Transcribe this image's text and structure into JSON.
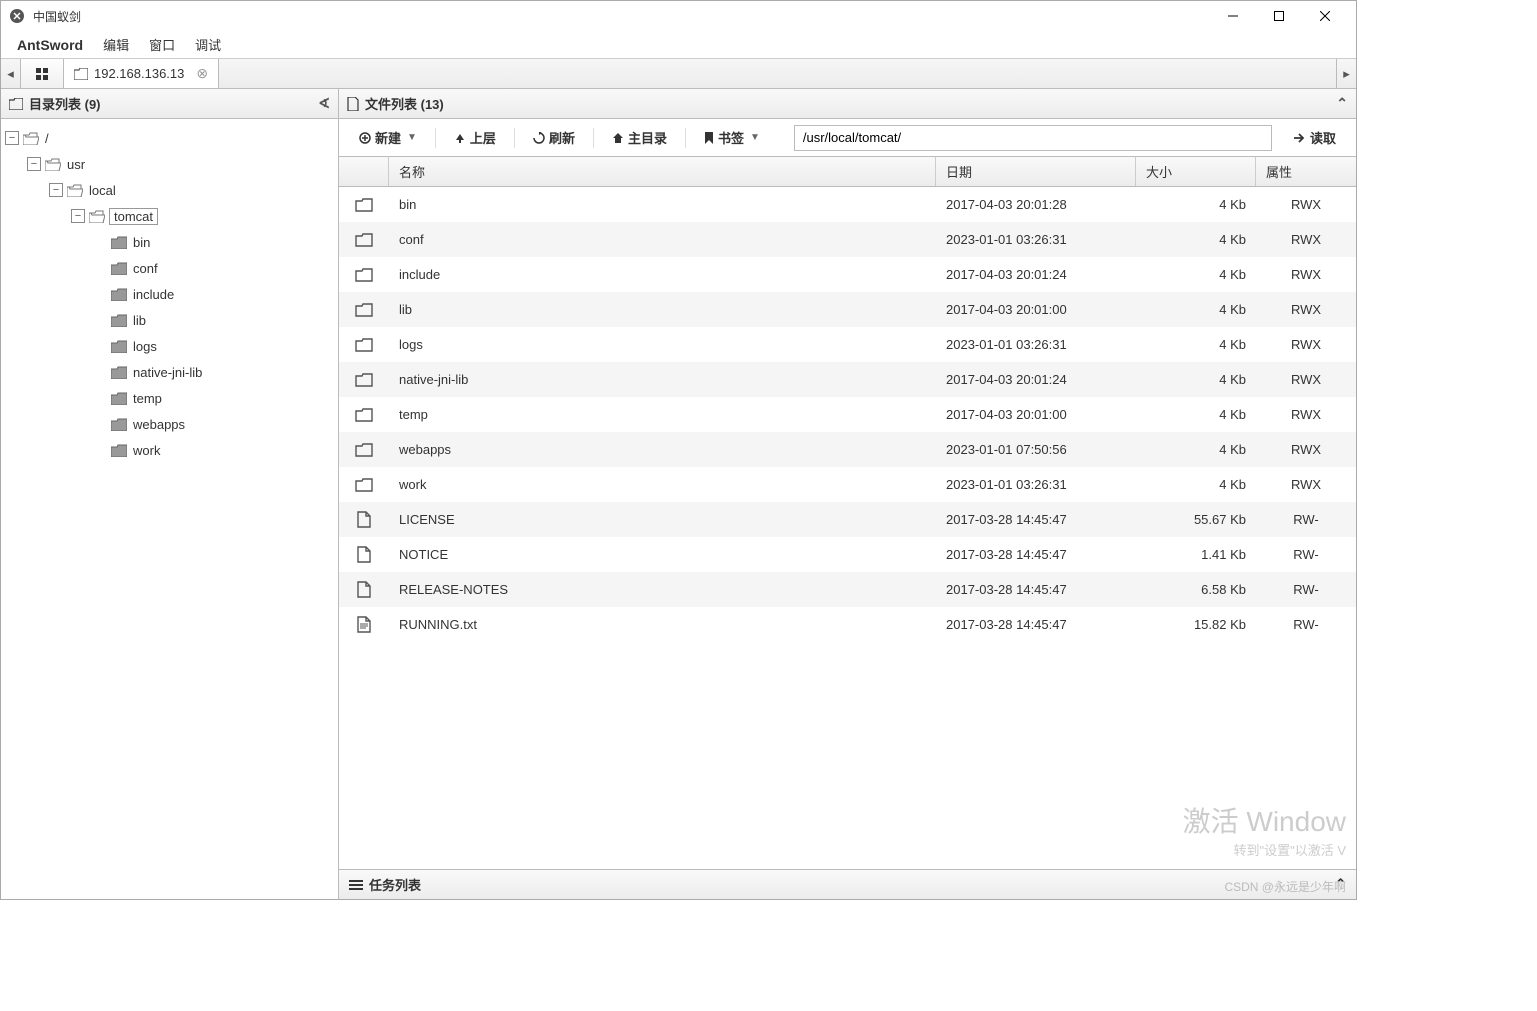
{
  "titlebar": {
    "title": "中国蚁剑"
  },
  "menu": {
    "items": [
      "AntSword",
      "编辑",
      "窗口",
      "调试"
    ]
  },
  "tabs": {
    "active": "192.168.136.13"
  },
  "sidebar": {
    "title": "目录列表 (9)",
    "tree": [
      {
        "level": 0,
        "label": "/",
        "toggle": "−",
        "open": true,
        "hasChildren": true,
        "selected": false
      },
      {
        "level": 1,
        "label": "usr",
        "toggle": "−",
        "open": true,
        "hasChildren": true,
        "selected": false
      },
      {
        "level": 2,
        "label": "local",
        "toggle": "−",
        "open": true,
        "hasChildren": true,
        "selected": false
      },
      {
        "level": 3,
        "label": "tomcat",
        "toggle": "−",
        "open": true,
        "hasChildren": true,
        "selected": true
      },
      {
        "level": 4,
        "label": "bin",
        "toggle": "",
        "open": false,
        "hasChildren": false,
        "selected": false
      },
      {
        "level": 4,
        "label": "conf",
        "toggle": "",
        "open": false,
        "hasChildren": false,
        "selected": false
      },
      {
        "level": 4,
        "label": "include",
        "toggle": "",
        "open": false,
        "hasChildren": false,
        "selected": false
      },
      {
        "level": 4,
        "label": "lib",
        "toggle": "",
        "open": false,
        "hasChildren": false,
        "selected": false
      },
      {
        "level": 4,
        "label": "logs",
        "toggle": "",
        "open": false,
        "hasChildren": false,
        "selected": false
      },
      {
        "level": 4,
        "label": "native-jni-lib",
        "toggle": "",
        "open": false,
        "hasChildren": false,
        "selected": false
      },
      {
        "level": 4,
        "label": "temp",
        "toggle": "",
        "open": false,
        "hasChildren": false,
        "selected": false
      },
      {
        "level": 4,
        "label": "webapps",
        "toggle": "",
        "open": false,
        "hasChildren": false,
        "selected": false
      },
      {
        "level": 4,
        "label": "work",
        "toggle": "",
        "open": false,
        "hasChildren": false,
        "selected": false
      }
    ]
  },
  "content": {
    "title": "文件列表 (13)",
    "toolbar": {
      "new": "新建",
      "up": "上层",
      "refresh": "刷新",
      "home": "主目录",
      "bookmark": "书签",
      "read": "读取"
    },
    "path": "/usr/local/tomcat/",
    "columns": {
      "name": "名称",
      "date": "日期",
      "size": "大小",
      "attr": "属性"
    },
    "rows": [
      {
        "type": "folder",
        "name": "bin",
        "date": "2017-04-03 20:01:28",
        "size": "4 Kb",
        "attr": "RWX"
      },
      {
        "type": "folder",
        "name": "conf",
        "date": "2023-01-01 03:26:31",
        "size": "4 Kb",
        "attr": "RWX"
      },
      {
        "type": "folder",
        "name": "include",
        "date": "2017-04-03 20:01:24",
        "size": "4 Kb",
        "attr": "RWX"
      },
      {
        "type": "folder",
        "name": "lib",
        "date": "2017-04-03 20:01:00",
        "size": "4 Kb",
        "attr": "RWX"
      },
      {
        "type": "folder",
        "name": "logs",
        "date": "2023-01-01 03:26:31",
        "size": "4 Kb",
        "attr": "RWX"
      },
      {
        "type": "folder",
        "name": "native-jni-lib",
        "date": "2017-04-03 20:01:24",
        "size": "4 Kb",
        "attr": "RWX"
      },
      {
        "type": "folder",
        "name": "temp",
        "date": "2017-04-03 20:01:00",
        "size": "4 Kb",
        "attr": "RWX"
      },
      {
        "type": "folder",
        "name": "webapps",
        "date": "2023-01-01 07:50:56",
        "size": "4 Kb",
        "attr": "RWX"
      },
      {
        "type": "folder",
        "name": "work",
        "date": "2023-01-01 03:26:31",
        "size": "4 Kb",
        "attr": "RWX"
      },
      {
        "type": "file",
        "name": "LICENSE",
        "date": "2017-03-28 14:45:47",
        "size": "55.67 Kb",
        "attr": "RW-"
      },
      {
        "type": "file",
        "name": "NOTICE",
        "date": "2017-03-28 14:45:47",
        "size": "1.41 Kb",
        "attr": "RW-"
      },
      {
        "type": "file",
        "name": "RELEASE-NOTES",
        "date": "2017-03-28 14:45:47",
        "size": "6.58 Kb",
        "attr": "RW-"
      },
      {
        "type": "textfile",
        "name": "RUNNING.txt",
        "date": "2017-03-28 14:45:47",
        "size": "15.82 Kb",
        "attr": "RW-"
      }
    ]
  },
  "taskbar": {
    "title": "任务列表"
  },
  "watermark": {
    "big": "激活 Window",
    "small": "转到\"设置\"以激活 V",
    "csdn": "CSDN @永远是少年啊"
  }
}
